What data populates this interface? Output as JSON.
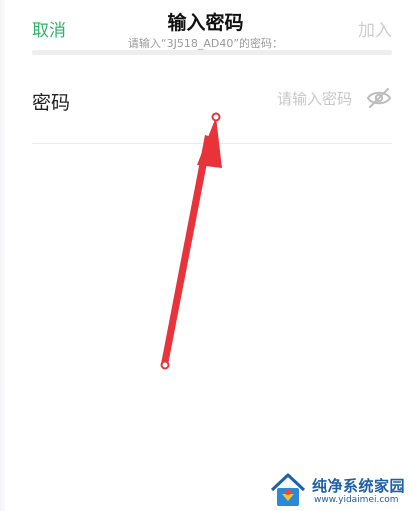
{
  "header": {
    "cancel_label": "取消",
    "title": "输入密码",
    "subtitle": "请输入“3J518_AD40”的密码：",
    "join_label": "加入"
  },
  "password_row": {
    "label": "密码",
    "placeholder": "请输入密码",
    "value": "",
    "visibility_icon": "eye-off-icon"
  },
  "annotation": {
    "arrow_color": "#e8333b"
  },
  "colors": {
    "accent": "#2fb36a",
    "disabled": "#cfcfcf",
    "watermark": "#1f5fa8"
  },
  "watermark": {
    "name": "纯净系统家园",
    "url": "www.yidaimei.com"
  }
}
